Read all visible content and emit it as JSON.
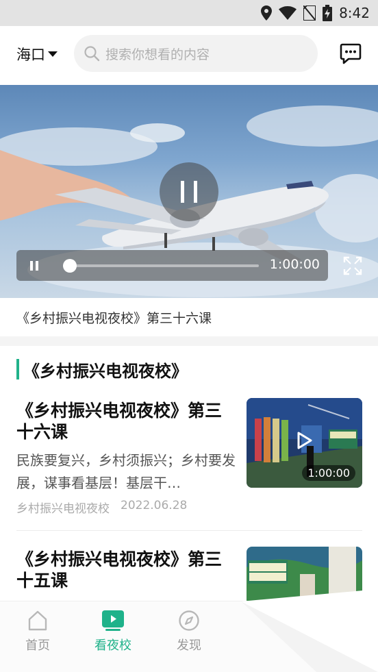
{
  "status_bar": {
    "time": "8:42"
  },
  "header": {
    "city": "海口",
    "search_placeholder": "搜索你想看的内容"
  },
  "player": {
    "duration": "1:00:00",
    "progress": 0.0,
    "now_playing": "《乡村振兴电视夜校》第三十六课"
  },
  "section": {
    "title": "《乡村振兴电视夜校》"
  },
  "items": [
    {
      "title": "《乡村振兴电视夜校》第三十六课",
      "desc": "民族要复兴，乡村须振兴；乡村要发展，谋事看基层！基层干…",
      "source": "乡村振兴电视夜校",
      "date": "2022.06.28",
      "duration": "1:00:00"
    },
    {
      "title": "《乡村振兴电视夜校》第三十五课"
    }
  ],
  "tabs": [
    {
      "label": "首页",
      "icon": "home-icon",
      "active": false
    },
    {
      "label": "看夜校",
      "icon": "tv-icon",
      "active": true
    },
    {
      "label": "发现",
      "icon": "compass-icon",
      "active": false
    }
  ],
  "colors": {
    "accent": "#1fb28a"
  }
}
